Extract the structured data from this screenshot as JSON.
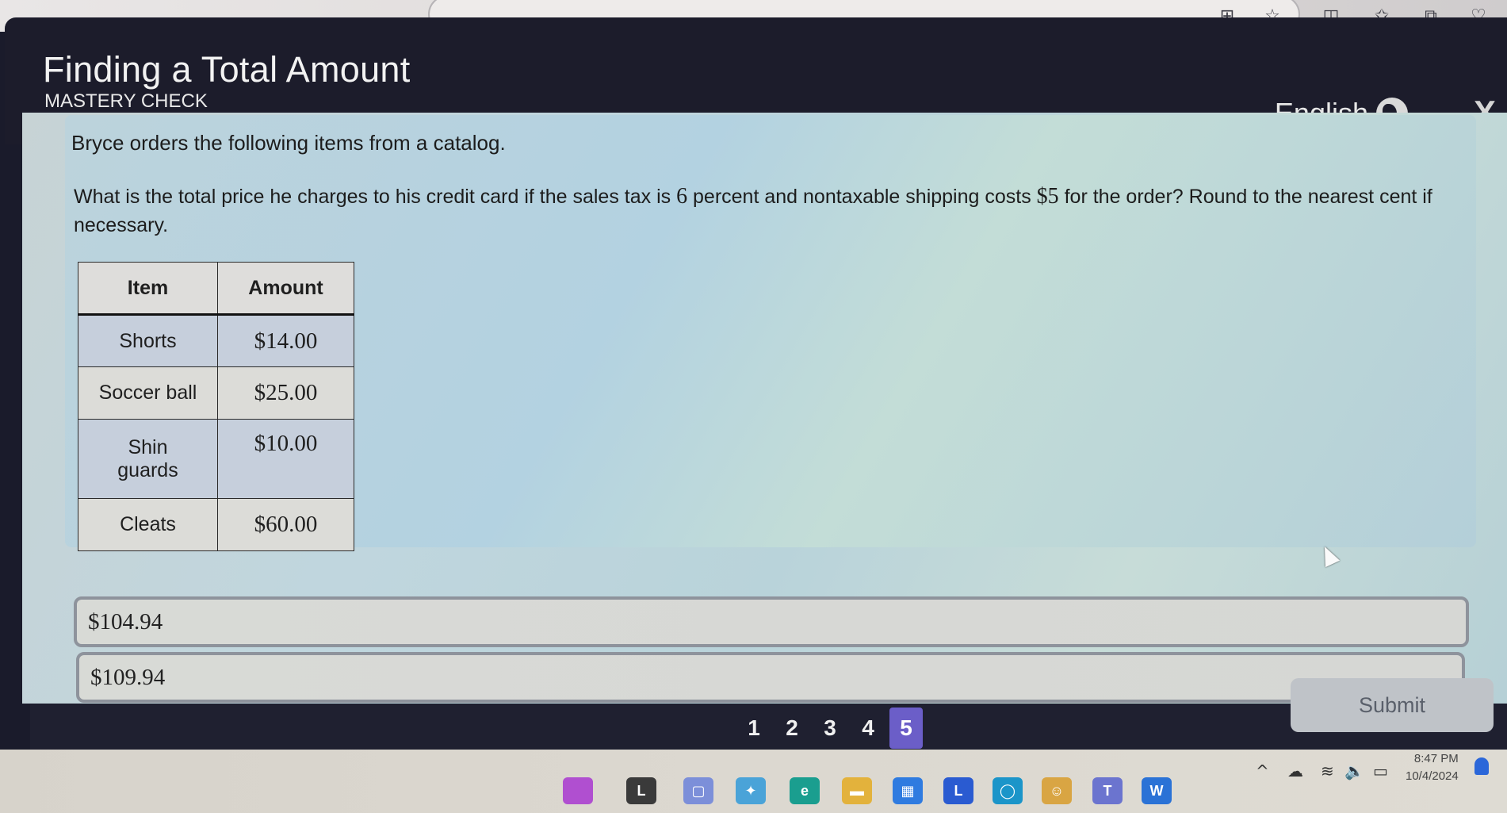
{
  "browser": {
    "toolbar_icons": [
      {
        "name": "apps-add-icon",
        "glyph": "⊞"
      },
      {
        "name": "favorite-star-icon",
        "glyph": "☆"
      },
      {
        "name": "split-screen-icon",
        "glyph": "◫"
      },
      {
        "name": "favorites-list-icon",
        "glyph": "✩"
      },
      {
        "name": "collections-icon",
        "glyph": "⧉"
      },
      {
        "name": "browser-essentials-icon",
        "glyph": "♡"
      }
    ]
  },
  "header": {
    "title": "Finding a Total Amount",
    "subtitle": "MASTERY CHECK",
    "language": "English",
    "close_glyph": "X"
  },
  "question": {
    "intro": "Bryce orders the following items from a catalog.",
    "text_parts": [
      "What is the total price he charges to his credit card if the sales tax is ",
      "6",
      " percent and nontaxable shipping costs ",
      "$5",
      " for the order? Round to the nearest cent if necessary."
    ]
  },
  "table": {
    "headers": [
      "Item",
      "Amount"
    ],
    "rows": [
      {
        "item": "Shorts",
        "amount": "$14.00"
      },
      {
        "item": "Soccer ball",
        "amount": "$25.00"
      },
      {
        "item": "Shin guards",
        "amount": "$10.00"
      },
      {
        "item": "Cleats",
        "amount": "$60.00"
      }
    ]
  },
  "choices": [
    {
      "label": "$104.94"
    },
    {
      "label": "$109.94"
    }
  ],
  "pagination": {
    "pages": [
      "1",
      "2",
      "3",
      "4",
      "5"
    ],
    "active": "5"
  },
  "submit_label": "Submit",
  "taskbar": {
    "apps": [
      {
        "name": "widgets-icon",
        "glyph": "",
        "color": "#b04fd0"
      },
      {
        "name": "stocks-icon",
        "glyph": "L",
        "color": "#3a3a3a"
      },
      {
        "name": "meet-icon",
        "glyph": "▢",
        "color": "#7c8fd9"
      },
      {
        "name": "copilot-icon",
        "glyph": "✦",
        "color": "#4aa3d8"
      },
      {
        "name": "edge-icon",
        "glyph": "e",
        "color": "#1a9e8f"
      },
      {
        "name": "file-explorer-icon",
        "glyph": "▬",
        "color": "#e3b23c"
      },
      {
        "name": "store-icon",
        "glyph": "▦",
        "color": "#2f7be0"
      },
      {
        "name": "app-l-icon",
        "glyph": "L",
        "color": "#2a5bd1"
      },
      {
        "name": "app-circle-icon",
        "glyph": "◯",
        "color": "#1b95c9"
      },
      {
        "name": "app-cartoon-icon",
        "glyph": "☺",
        "color": "#d9a543"
      },
      {
        "name": "teams-icon",
        "glyph": "T",
        "color": "#6b74cf"
      },
      {
        "name": "word-icon",
        "glyph": "W",
        "color": "#2a72d6"
      }
    ],
    "tray_icons": [
      {
        "name": "chevron-up-icon",
        "glyph": "^"
      },
      {
        "name": "onedrive-icon",
        "glyph": "☁"
      },
      {
        "name": "wifi-icon",
        "glyph": "≋"
      },
      {
        "name": "volume-icon",
        "glyph": "🔈"
      },
      {
        "name": "battery-icon",
        "glyph": "▭"
      }
    ],
    "time": "8:47 PM",
    "date": "10/4/2024"
  }
}
